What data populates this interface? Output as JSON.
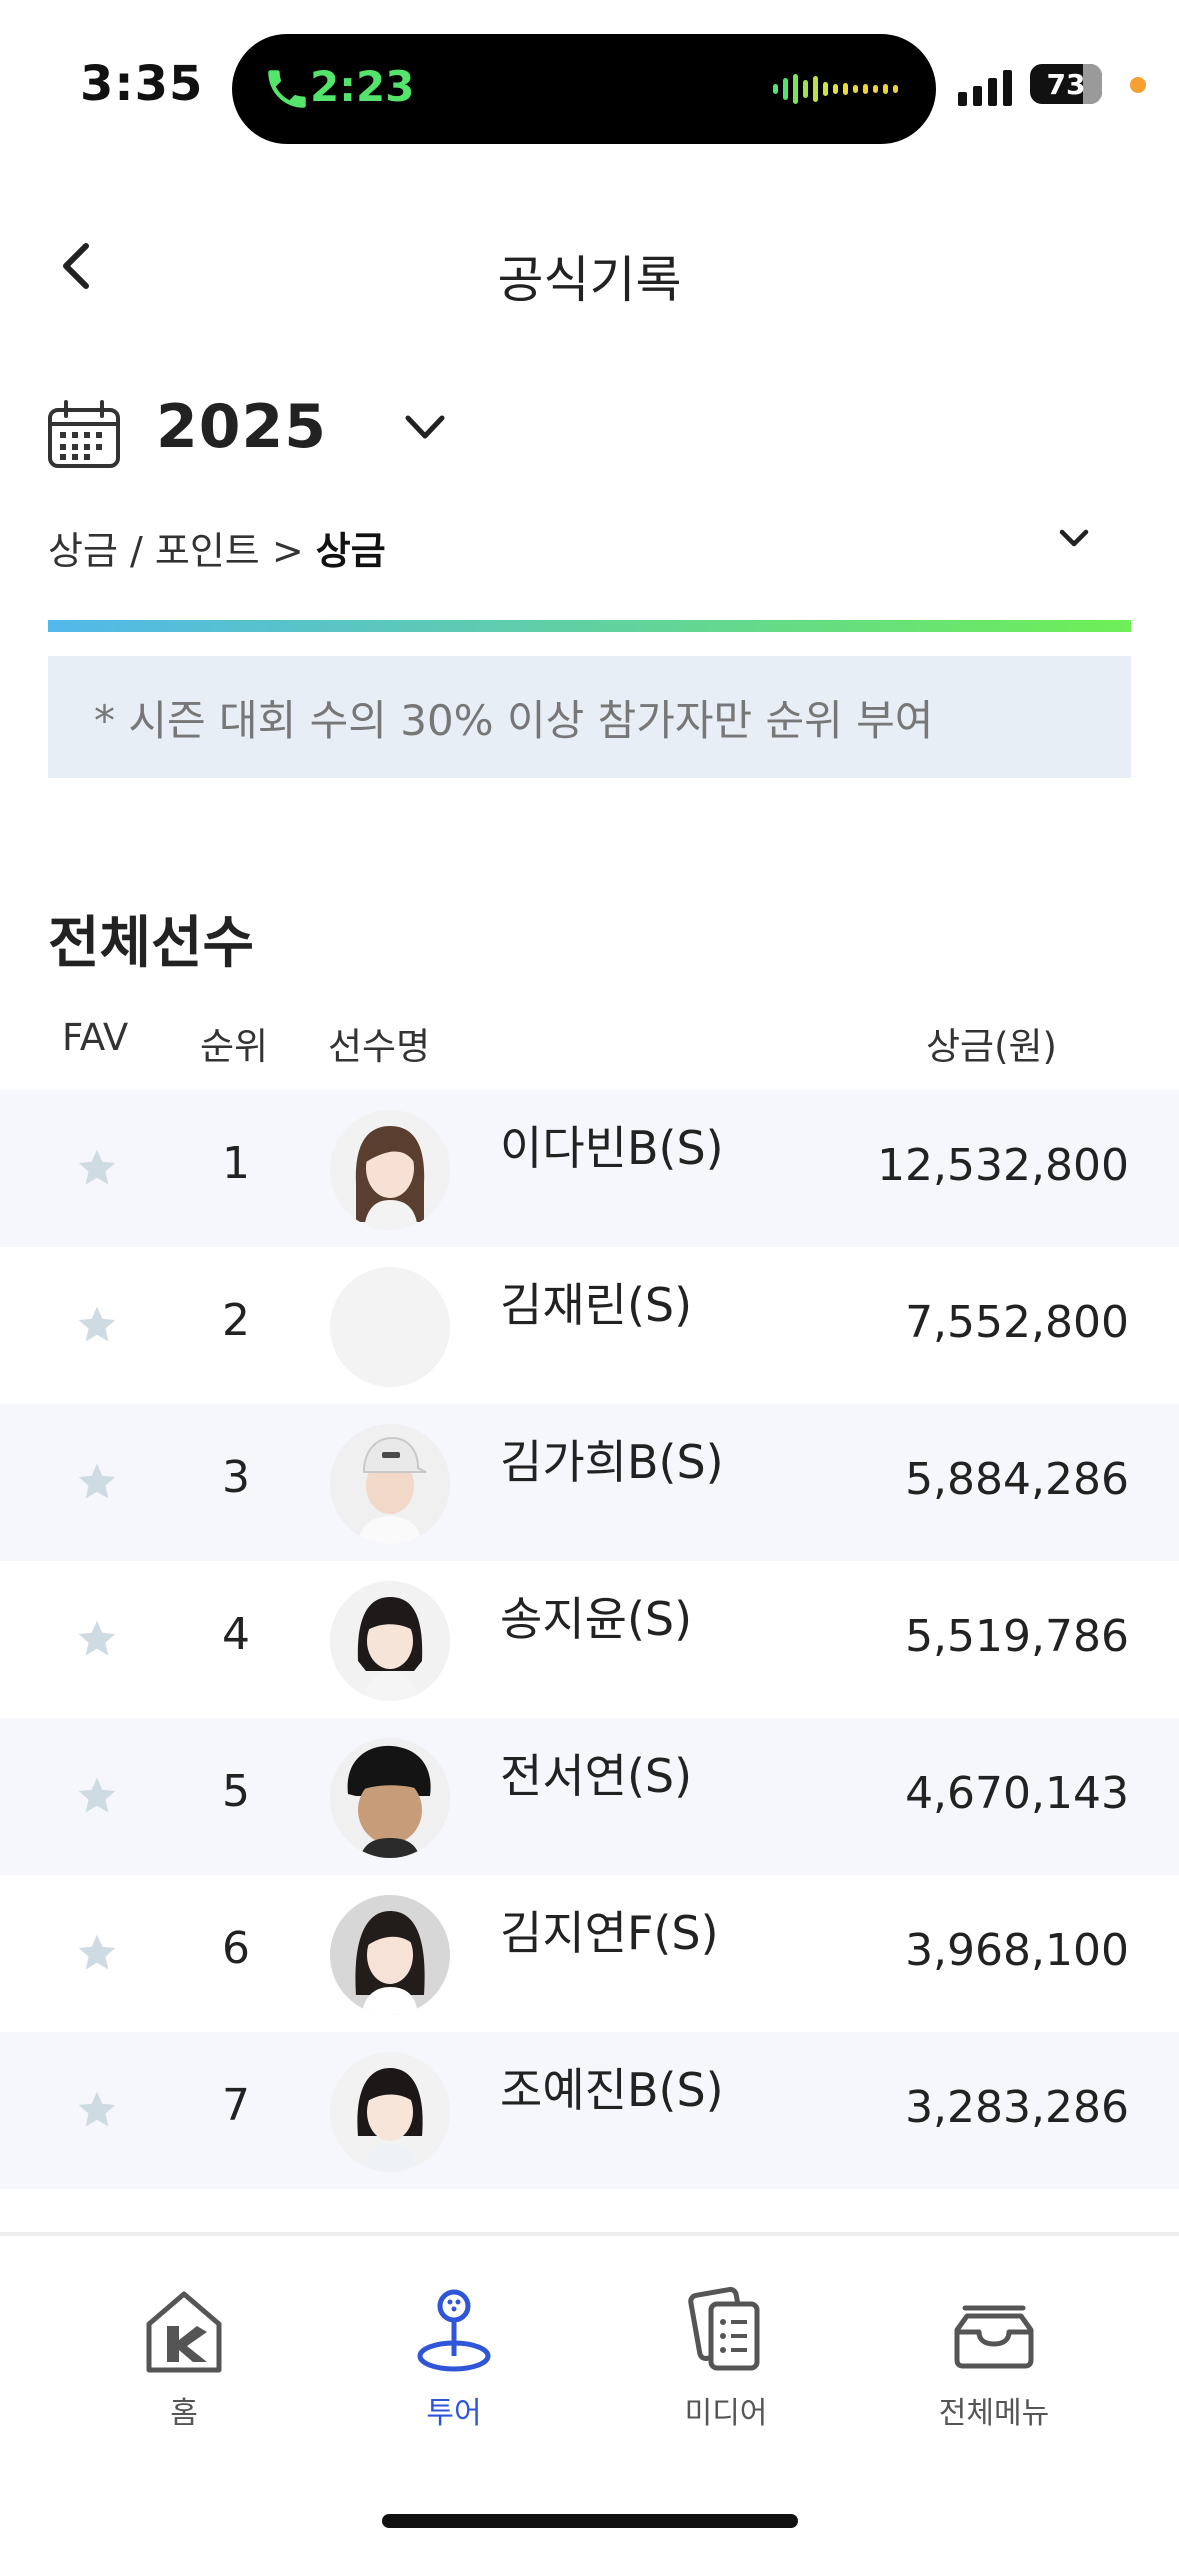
{
  "status_bar": {
    "time": "3:35",
    "call_time": "2:23",
    "battery": "73",
    "battery_level": 0.73,
    "accent_call": "#54e36b"
  },
  "header": {
    "back_icon": "chevron-left-icon",
    "title": "공식기록"
  },
  "filters": {
    "calendar_icon": "calendar-icon",
    "year": "2025",
    "breadcrumb_prefix": "상금 / 포인트 >",
    "breadcrumb_current": "상금"
  },
  "notice": "* 시즌 대회 수의 30% 이상 참가자만 순위 부여",
  "section_title": "전체선수",
  "table": {
    "headers": {
      "fav": "FAV",
      "rank": "순위",
      "name": "선수명",
      "prize": "상금(원)"
    },
    "rows": [
      {
        "rank": "1",
        "name": "이다빈B(S)",
        "prize": "12,532,800",
        "avatar": "photo"
      },
      {
        "rank": "2",
        "name": "김재린(S)",
        "prize": "7,552,800",
        "avatar": "blank"
      },
      {
        "rank": "3",
        "name": "김가희B(S)",
        "prize": "5,884,286",
        "avatar": "photo"
      },
      {
        "rank": "4",
        "name": "송지윤(S)",
        "prize": "5,519,786",
        "avatar": "photo"
      },
      {
        "rank": "5",
        "name": "전서연(S)",
        "prize": "4,670,143",
        "avatar": "photo"
      },
      {
        "rank": "6",
        "name": "김지연F(S)",
        "prize": "3,968,100",
        "avatar": "photo"
      },
      {
        "rank": "7",
        "name": "조예진B(S)",
        "prize": "3,283,286",
        "avatar": "photo"
      }
    ]
  },
  "bottom_nav": {
    "items": [
      {
        "label": "홈",
        "icon": "home-icon",
        "active": false
      },
      {
        "label": "투어",
        "icon": "tour-pin-icon",
        "active": true
      },
      {
        "label": "미디어",
        "icon": "media-cards-icon",
        "active": false
      },
      {
        "label": "전체메뉴",
        "icon": "inbox-menu-icon",
        "active": false
      }
    ]
  },
  "colors": {
    "accent": "#2f56d8",
    "notice_bg": "#e7eef6",
    "gradient_start": "#52b8ea",
    "gradient_end": "#6eef55"
  }
}
